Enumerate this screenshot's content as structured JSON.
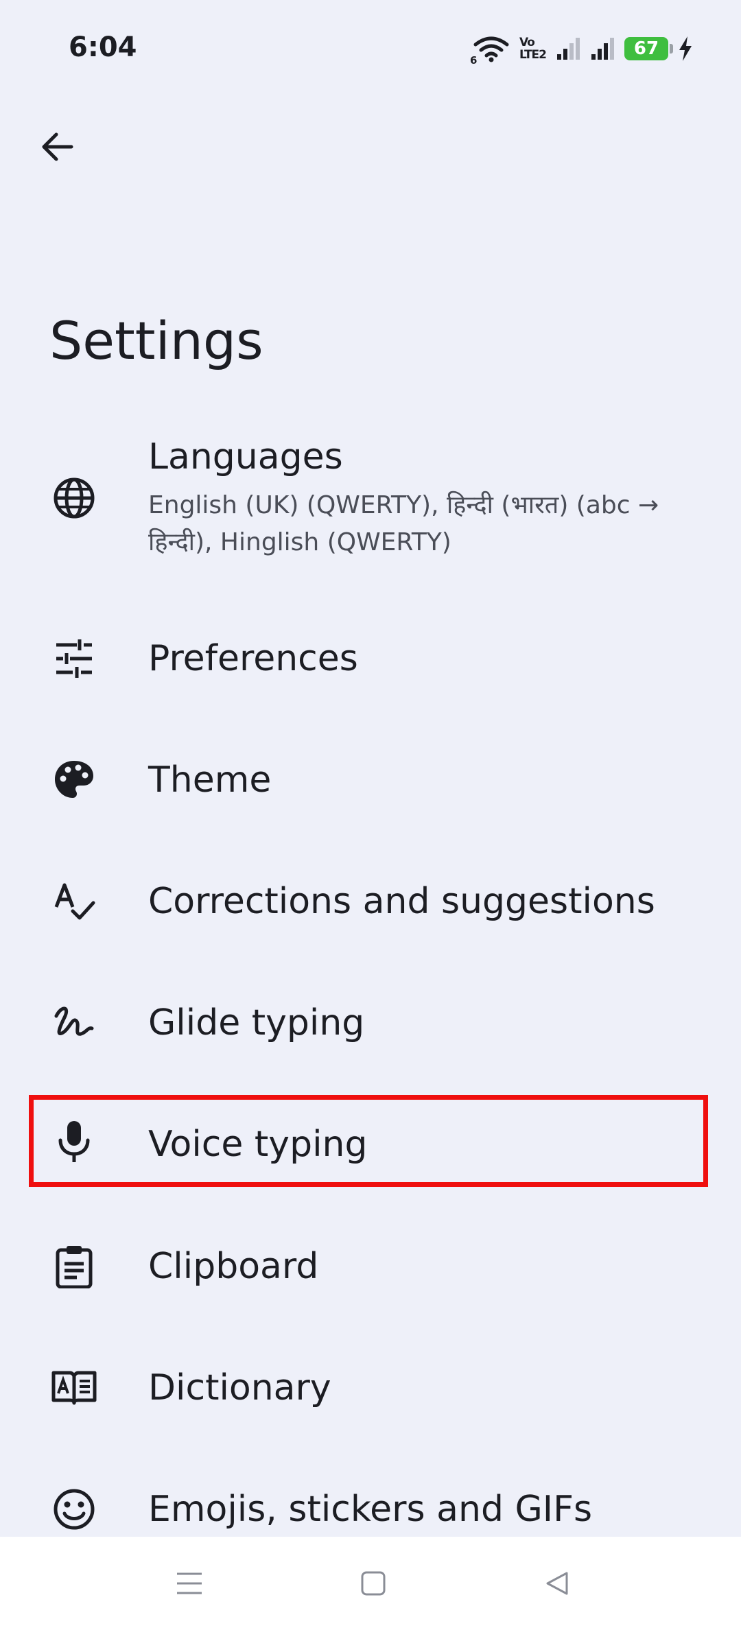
{
  "status_bar": {
    "time": "6:04",
    "network_gen": "6",
    "volte_top": "Vo",
    "volte_bottom": "LTE2",
    "battery_level": "67"
  },
  "header": {
    "back_icon": "arrow-left-icon",
    "title": "Settings"
  },
  "settings": {
    "items": [
      {
        "icon": "globe-icon",
        "label": "Languages",
        "sublabel": "English (UK) (QWERTY), हिन्दी (भारत) (abc → हिन्दी), Hinglish (QWERTY)"
      },
      {
        "icon": "sliders-icon",
        "label": "Preferences"
      },
      {
        "icon": "palette-icon",
        "label": "Theme"
      },
      {
        "icon": "spellcheck-icon",
        "label": "Corrections and suggestions"
      },
      {
        "icon": "gesture-icon",
        "label": "Glide typing"
      },
      {
        "icon": "microphone-icon",
        "label": "Voice typing"
      },
      {
        "icon": "clipboard-icon",
        "label": "Clipboard"
      },
      {
        "icon": "dictionary-icon",
        "label": "Dictionary"
      },
      {
        "icon": "emoji-icon",
        "label": "Emojis, stickers and GIFs"
      }
    ]
  },
  "highlight": {
    "target": "Voice typing",
    "color": "#ef0f0f"
  },
  "nav_bar": {
    "menu_icon": "menu-icon",
    "home_icon": "home-square-icon",
    "back_icon": "back-triangle-icon"
  }
}
